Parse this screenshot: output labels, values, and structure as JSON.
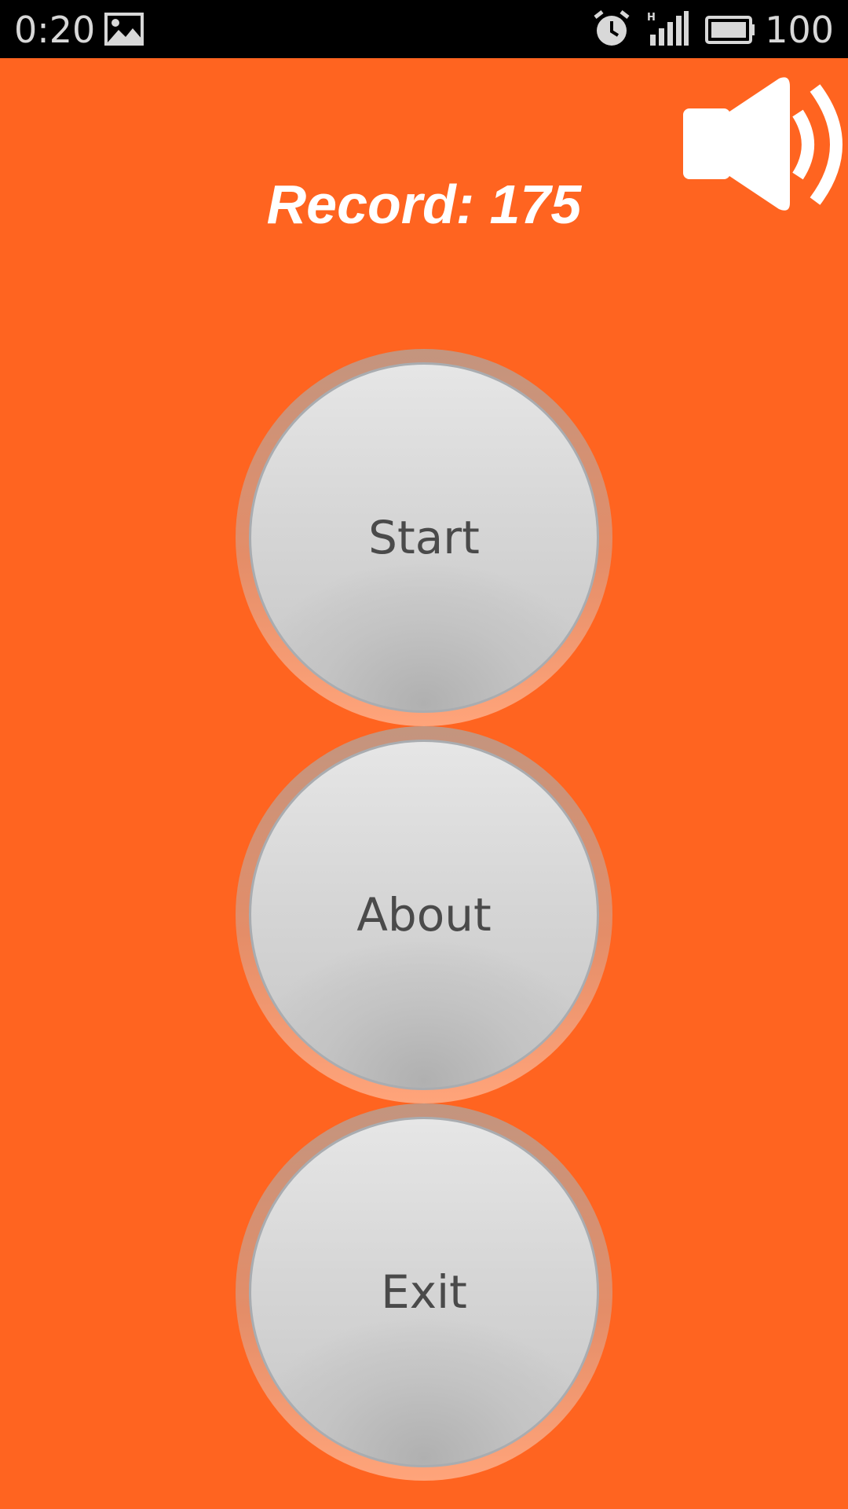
{
  "status_bar": {
    "time": "0:20",
    "battery_level": "100",
    "icons": [
      "image-icon",
      "alarm-icon",
      "signal-icon",
      "battery-icon"
    ]
  },
  "record": {
    "text": "Record: 175"
  },
  "menu": {
    "start_label": "Start",
    "about_label": "About",
    "exit_label": "Exit"
  },
  "sound": {
    "icon": "speaker-on-icon",
    "state": "on"
  },
  "colors": {
    "background": "#ff6420",
    "record_text": "#ffffff",
    "button_text": "#4a4a4a"
  }
}
